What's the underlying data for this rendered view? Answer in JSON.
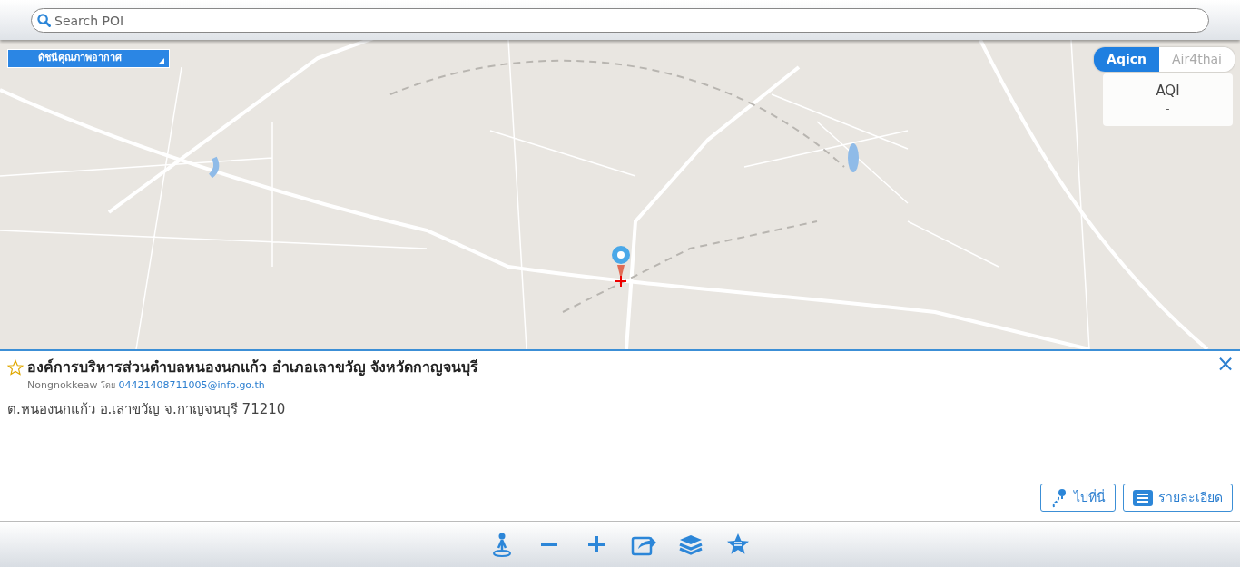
{
  "search": {
    "placeholder": "Search POI"
  },
  "aqi_dropdown": {
    "label": "ดัชนีคุณภาพอากาศ"
  },
  "aqi_tabs": [
    {
      "label": "Aqicn",
      "selected": true
    },
    {
      "label": "Air4thai",
      "selected": false
    }
  ],
  "aqi_card": {
    "title": "AQI",
    "value": "-"
  },
  "poi_panel": {
    "favorite": false,
    "title": "องค์การบริหารส่วนตำบลหนองนกแก้ว อำเภอเลาขวัญ จังหวัดกาญจนบุรี",
    "source": "Nongnokkeaw",
    "by": "โดย",
    "contributor": "04421408711005@info.go.th",
    "address": "ต.หนองนกแก้ว อ.เลาขวัญ จ.กาญจนบุรี 71210",
    "close": "×",
    "buttons": [
      {
        "kind": "route",
        "label": "ไปที่นี่"
      },
      {
        "kind": "details",
        "label": "รายละเอียด"
      }
    ]
  },
  "toolbar": [
    {
      "kind": "locate"
    },
    {
      "kind": "zoom-out"
    },
    {
      "kind": "zoom-in"
    },
    {
      "kind": "share"
    },
    {
      "kind": "layers"
    },
    {
      "kind": "favorites"
    }
  ]
}
